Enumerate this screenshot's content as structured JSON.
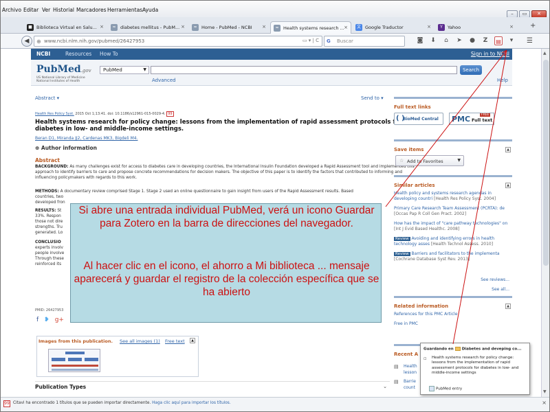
{
  "browser": {
    "menu": [
      "Archivo",
      "Editar",
      "Ver",
      "Historial",
      "Marcadores",
      "Herramientas",
      "Ayuda"
    ],
    "tabs": [
      {
        "label": "Biblioteca Virtual en Salu...",
        "icon": "dark-square-icon"
      },
      {
        "label": "diabetes mellitus - PubM...",
        "icon": "ncbi-icon"
      },
      {
        "label": "Home - PubMed - NCBI",
        "icon": "ncbi-icon"
      },
      {
        "label": "Health systems research ...",
        "icon": "ncbi-icon"
      },
      {
        "label": "Google Traductor",
        "icon": "translate-icon"
      },
      {
        "label": "Yahoo",
        "icon": "yahoo-icon"
      }
    ],
    "url": "www.ncbi.nlm.nih.gov/pubmed/26427953",
    "search_placeholder": "Buscar",
    "search_engine_label": "G"
  },
  "ncbi": {
    "logo": "NCBI",
    "resources": "Resources",
    "how_to": "How To",
    "sign_in": "Sign in to NCBI"
  },
  "pubmed": {
    "logo_main": "PubMed",
    "logo_gov": ".gov",
    "sub1": "US National Library of Medicine",
    "sub2": "National Institutes of Health",
    "db_select": "PubMed",
    "search_button": "Search",
    "advanced": "Advanced",
    "help": "Help"
  },
  "article": {
    "format_dropdown": "Abstract",
    "send_to": "Send to",
    "journal": "Health Res Policy Syst.",
    "citation": " 2015 Oct 1;13:41. doi: 10.1186/s12961-015-0029-4.",
    "title": "Health systems research for policy change: lessons from the implementation of rapid assessment protocols for diabetes in low- and middle-income settings.",
    "authors": "Beran D1, Miranda JJ2, Cardenas MK3, Bigdeli M4.",
    "author_info": "Author information",
    "abstract_head": "Abstract",
    "background_label": "BACKGROUND:",
    "background": "As many challenges exist for access to diabetes care in developing countries, the International Insulin Foundation developed a Rapid Assessment tool and implemented this approach to identify barriers to care and propose concrete recommendations for decision makers. The objective of this paper is to identify the factors that contributed to informing and influencing policymakers with regards to this work.",
    "methods_label": "METHODS:",
    "methods": "A documentary review comprised Stage 1. Stage 2 used an online questionnaire to gain insight from users of the Rapid Assessment results. Based",
    "methods_line2": "countries, two",
    "methods_line3": "developed fron",
    "results_label": "RESULTS:",
    "results_line1": "St",
    "results_line2": "33%. Respon",
    "results_line3": "those not dire",
    "results_line4": "strengths. Tru",
    "results_line5": "generated. Lo",
    "conclusion_label": "CONCLUSIO",
    "conclusion_line1": "experts involv",
    "conclusion_line2": "people involve",
    "conclusion_line3": "Through these",
    "conclusion_line4": "reinforced its",
    "pmid": "PMID: 26427953"
  },
  "images_box": {
    "title": "Images from this publication.",
    "see_all": "See all images (1)",
    "free_text": "Free text"
  },
  "publication_types": "Publication Types",
  "sidebar": {
    "full_text_title": "Full text links",
    "biomed": "BioMed Central",
    "pmc": "PMC",
    "pmc_full": "Full text",
    "pmc_free": "FREE",
    "save_items": "Save items",
    "add_favorites": "Add to Favorites",
    "similar_title": "Similar articles",
    "similar": [
      {
        "text": "Health policy and systems research agendas in developing countri",
        "ref": " [Health Res Policy Syst. 2004]",
        "review": false
      },
      {
        "text": "Primary Care Research Team Assessment (PCRTA): de",
        "ref": " [Occas Pap R Coll Gen Pract. 2002]",
        "review": false
      },
      {
        "text": "How has the impact of \"care pathway technologies\" on",
        "ref": " [Int J Evid Based Healthc. 2008]",
        "review": false
      },
      {
        "text": " Avoiding and identifying errors in health technology asses",
        "ref": " [Health Technol Assess. 2010]",
        "review": true
      },
      {
        "text": " Barriers and facilitators to the implementa",
        "ref": " [Cochrane Database Syst Rev. 2013]",
        "review": true
      }
    ],
    "review_label": "Review",
    "see_reviews": "See reviews...",
    "see_all": "See all...",
    "related_title": "Related information",
    "related": [
      "References for this PMC Article",
      "Free in PMC"
    ],
    "recent_title": "Recent A",
    "recent": [
      "Health",
      "lesson",
      "Barrie",
      "count"
    ]
  },
  "caption": {
    "line1": "Si abre una entrada individual PubMed, verá un icono Guardar para Zotero en la barra de direcciones del navegador.",
    "line2": "Al hacer clic en el icono, el ahorro a Mi biblioteca ... mensaje aparecerá y guardar el registro de la colección específica que se ha abierto"
  },
  "zotero_popup": {
    "saving_to": "Guardando en",
    "collection": "Diabetes and deveping co...",
    "item": "Health systems research for policy change: lessons from the implementation of rapid assessment protocols for diabetes in low- and middle-income settings",
    "sub_item": "PubMed entry"
  },
  "status": {
    "text": "Citavi ha encontrado 1 títulos que se pueden importar directamente.",
    "link": "Haga clic aquí para importar los títulos."
  },
  "colors": {
    "ncbi_blue": "#2d5f93",
    "pubmed_orange": "#b95a22",
    "link_blue": "#2f64a8",
    "caption_text": "#cc1111",
    "caption_bg": "#b0d8e2"
  }
}
